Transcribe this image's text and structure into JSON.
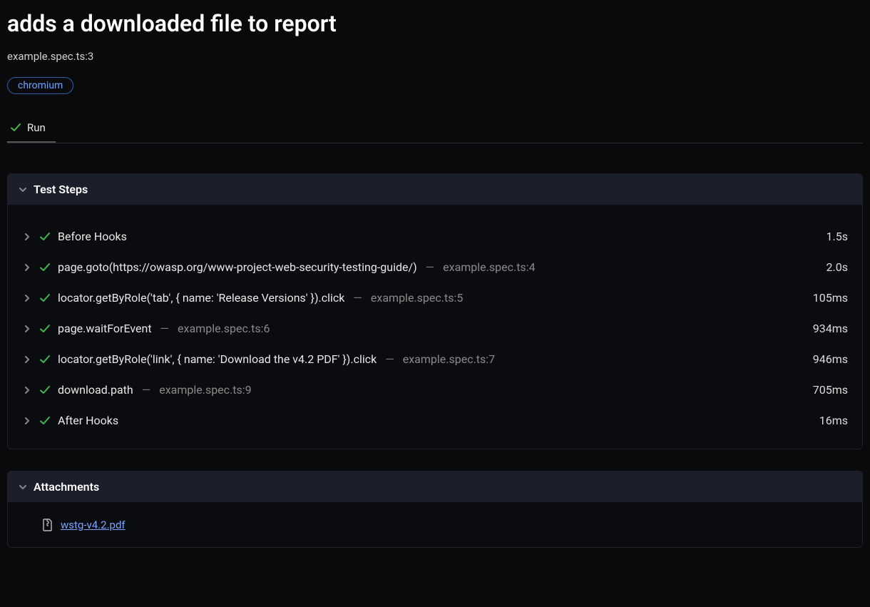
{
  "header": {
    "title": "adds a downloaded file to report",
    "file_location": "example.spec.ts:3",
    "tag": "chromium"
  },
  "tab": {
    "label": "Run"
  },
  "sections": {
    "test_steps": "Test Steps",
    "attachments": "Attachments"
  },
  "steps": [
    {
      "title": "Before Hooks",
      "loc": "",
      "duration": "1.5s"
    },
    {
      "title": "page.goto(https://owasp.org/www-project-web-security-testing-guide/)",
      "loc": "example.spec.ts:4",
      "duration": "2.0s"
    },
    {
      "title": "locator.getByRole('tab', { name: 'Release Versions' }).click",
      "loc": "example.spec.ts:5",
      "duration": "105ms"
    },
    {
      "title": "page.waitForEvent",
      "loc": "example.spec.ts:6",
      "duration": "934ms"
    },
    {
      "title": "locator.getByRole('link', { name: 'Download the v4.2 PDF' }).click",
      "loc": "example.spec.ts:7",
      "duration": "946ms"
    },
    {
      "title": "download.path",
      "loc": "example.spec.ts:9",
      "duration": "705ms"
    },
    {
      "title": "After Hooks",
      "loc": "",
      "duration": "16ms"
    }
  ],
  "attachments": [
    {
      "name": "wstg-v4.2.pdf"
    }
  ],
  "locSeparator": "—"
}
